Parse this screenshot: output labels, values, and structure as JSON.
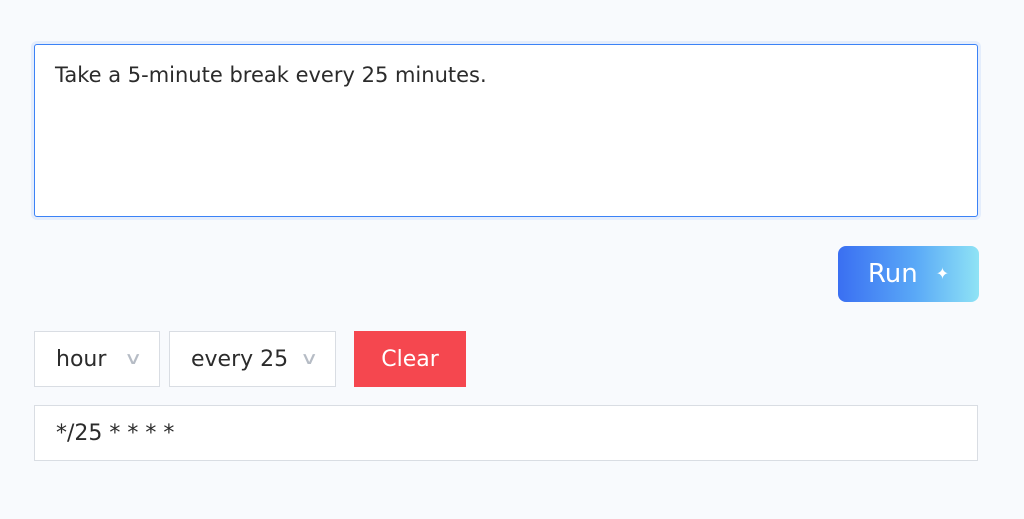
{
  "prompt": {
    "text": "Take a 5-minute break every 25 minutes."
  },
  "run_button": {
    "label": "Run",
    "icon": "sparkle-icon",
    "glyph": "✦"
  },
  "controls": {
    "unit_select": {
      "value": "hour",
      "icon": "chevron-down-icon",
      "glyph": "∨"
    },
    "interval_select": {
      "value": "every 25",
      "icon": "chevron-down-icon",
      "glyph": "∨"
    },
    "clear_label": "Clear"
  },
  "output": {
    "cron": "*/25 * * * *"
  },
  "colors": {
    "accent": "#3b82f6",
    "clear": "#f5474f",
    "run_gradient_start": "#3a6ff2",
    "run_gradient_end": "#8fe3f5"
  }
}
